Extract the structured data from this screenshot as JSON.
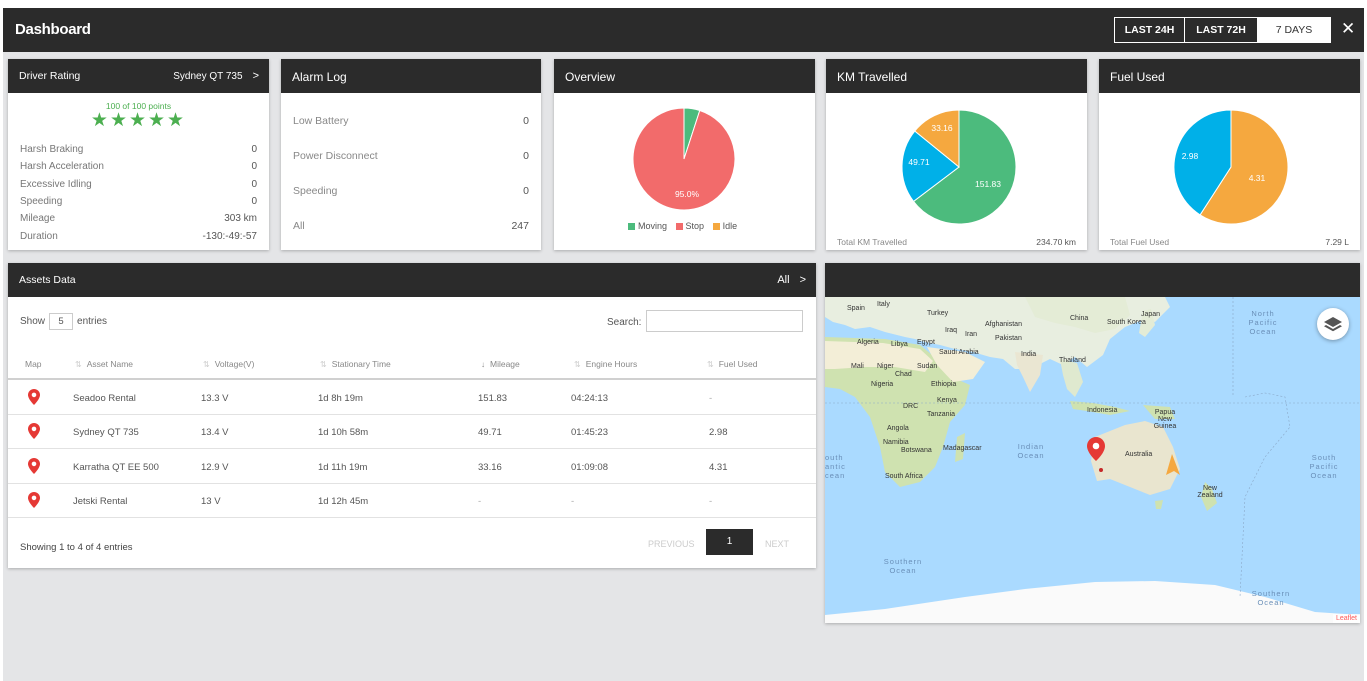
{
  "header": {
    "title": "Dashboard",
    "ranges": [
      "LAST 24H",
      "LAST 72H",
      "7 DAYS"
    ],
    "selected_range": "7 DAYS",
    "close": "✕"
  },
  "driver_rating": {
    "title": "Driver Rating",
    "vehicle": "Sydney QT 735",
    "points": "100 of 100 points",
    "stars": "★★★★★",
    "rows": [
      {
        "label": "Harsh Braking",
        "value": "0"
      },
      {
        "label": "Harsh Acceleration",
        "value": "0"
      },
      {
        "label": "Excessive Idling",
        "value": "0"
      },
      {
        "label": "Speeding",
        "value": "0"
      },
      {
        "label": "Mileage",
        "value": "303 km"
      },
      {
        "label": "Duration",
        "value": "-130:-49:-57"
      }
    ]
  },
  "alarm_log": {
    "title": "Alarm Log",
    "rows": [
      {
        "label": "Low Battery",
        "value": "0"
      },
      {
        "label": "Power Disconnect",
        "value": "0"
      },
      {
        "label": "Speeding",
        "value": "0"
      },
      {
        "label": "All",
        "value": "247"
      }
    ]
  },
  "overview": {
    "title": "Overview",
    "slice_label": "95.0%",
    "legend": [
      "Moving",
      "Stop",
      "Idle"
    ]
  },
  "km_travelled": {
    "title": "KM Travelled",
    "labels": [
      "151.83",
      "49.71",
      "33.16"
    ],
    "footer_label": "Total KM Travelled",
    "footer_value": "234.70 km"
  },
  "fuel_used": {
    "title": "Fuel Used",
    "labels": [
      "4.31",
      "2.98"
    ],
    "footer_label": "Total Fuel Used",
    "footer_value": "7.29 L"
  },
  "chart_data": [
    {
      "type": "pie",
      "labels": [
        "Moving",
        "Stop",
        "Idle"
      ],
      "values": [
        5.0,
        95.0,
        0.0
      ],
      "colors": [
        "#4cbb7d",
        "#f26b6b",
        "#f5a83f"
      ]
    },
    {
      "type": "pie",
      "labels": [
        "151.83",
        "49.71",
        "33.16"
      ],
      "values": [
        151.83,
        49.71,
        33.16
      ],
      "colors": [
        "#4cbb7d",
        "#00b0e8",
        "#f5a83f"
      ]
    },
    {
      "type": "pie",
      "labels": [
        "4.31",
        "2.98"
      ],
      "values": [
        4.31,
        2.98
      ],
      "colors": [
        "#f5a83f",
        "#00b0e8"
      ]
    }
  ],
  "assets": {
    "title": "Assets Data",
    "filter": "All",
    "show_label": "Show",
    "entries_value": "5",
    "entries_label": "entries",
    "search_label": "Search:",
    "columns": [
      "Map",
      "Asset Name",
      "Voltage(V)",
      "Stationary Time",
      "Mileage",
      "Engine Hours",
      "Fuel Used"
    ],
    "rows": [
      [
        "Seadoo Rental",
        "13.3 V",
        "1d 8h 19m",
        "151.83",
        "04:24:13",
        "-"
      ],
      [
        "Sydney QT 735",
        "13.4 V",
        "1d 10h 58m",
        "49.71",
        "01:45:23",
        "2.98"
      ],
      [
        "Karratha QT EE 500",
        "12.9 V",
        "1d 11h 19m",
        "33.16",
        "01:09:08",
        "4.31"
      ],
      [
        "Jetski Rental",
        "13 V",
        "1d 12h 45m",
        "-",
        "-",
        "-"
      ]
    ],
    "showing": "Showing 1 to 4 of 4 entries",
    "previous": "PREVIOUS",
    "page": "1",
    "next": "NEXT"
  },
  "map": {
    "countries": [
      "Spain",
      "Italy",
      "Turkey",
      "Iraq",
      "Iran",
      "Afghanistan",
      "Pakistan",
      "China",
      "South Korea",
      "Japan",
      "Algeria",
      "Libya",
      "Egypt",
      "Saudi Arabia",
      "India",
      "Thailand",
      "Mali",
      "Niger",
      "Chad",
      "Sudan",
      "Nigeria",
      "Ethiopia",
      "Kenya",
      "DRC",
      "Tanzania",
      "Angola",
      "Namibia",
      "Botswana",
      "Madagascar",
      "South Africa",
      "Indonesia",
      "Papua New Guinea",
      "Australia",
      "New Zealand"
    ],
    "oceans": {
      "north_pacific": "North Pacific Ocean",
      "indian": "Indian Ocean",
      "south_atlantic": "outh antic cean",
      "south_pacific": "South Pacific Ocean",
      "southern_left": "Southern Ocean",
      "southern_right": "Southern Ocean"
    },
    "attribution": "Leaflet"
  }
}
